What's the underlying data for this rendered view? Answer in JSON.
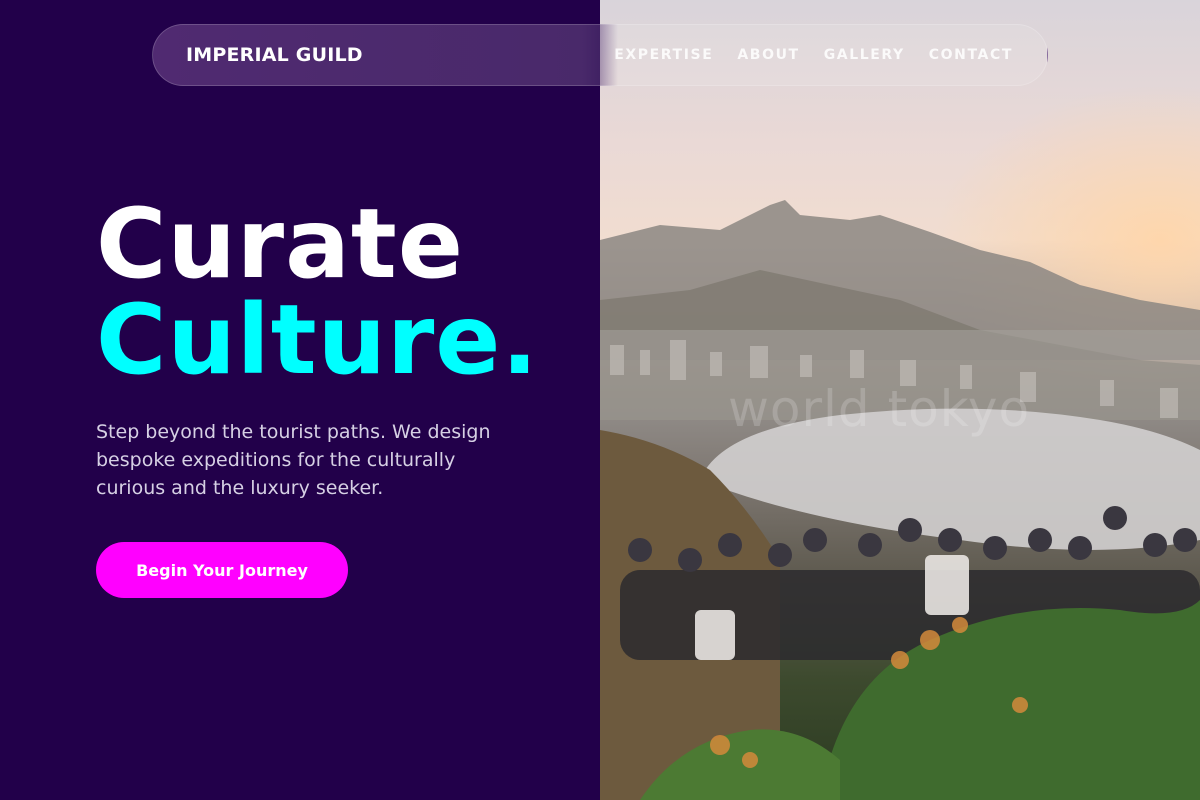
{
  "nav": {
    "brand": "IMPERIAL GUILD",
    "links": [
      {
        "label": "EXPERTISE"
      },
      {
        "label": "ABOUT"
      },
      {
        "label": "GALLERY"
      },
      {
        "label": "CONTACT"
      }
    ]
  },
  "hero": {
    "title_line1": "Curate",
    "title_line2": "Culture.",
    "description": "Step beyond the tourist paths. We design bespoke expeditions for the culturally curious and the luxury seeker.",
    "cta_label": "Begin Your Journey"
  },
  "image": {
    "watermark": "world tokyo"
  },
  "colors": {
    "background": "#22004a",
    "accent_cyan": "#00ffff",
    "accent_magenta": "#ff00ff",
    "text_white": "#ffffff",
    "text_muted": "#d6d0e4"
  }
}
